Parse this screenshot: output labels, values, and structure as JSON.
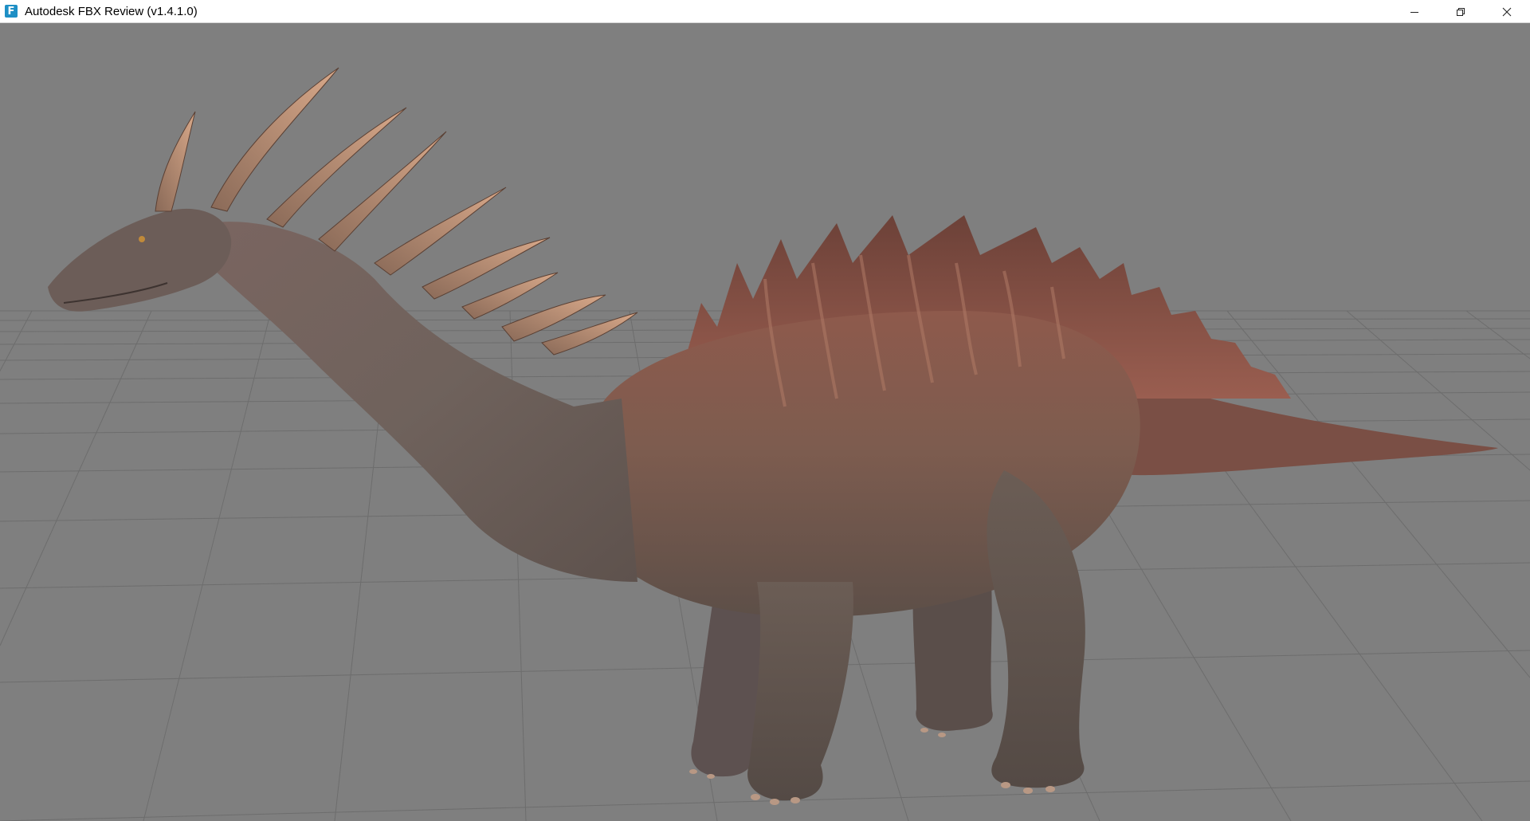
{
  "window": {
    "title": "Autodesk FBX Review (v1.4.1.0)",
    "app_icon_glyph": "F",
    "app_icon_name": "fbx-review-app-icon",
    "controls": {
      "minimize_icon": "minimize-icon",
      "restore_icon": "restore-icon",
      "close_icon": "close-icon"
    }
  },
  "viewport": {
    "background_color": "#7f7f7f",
    "grid_color": "#6e6e6e",
    "model_name": "dinosaur-model"
  }
}
